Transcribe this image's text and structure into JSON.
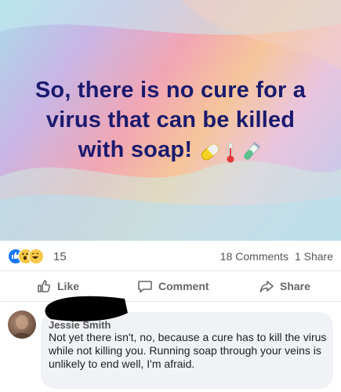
{
  "post": {
    "image_text_lines": [
      "So, there is no cure for a",
      "virus that can be killed",
      "with soap!"
    ],
    "emojis": [
      "pill-icon",
      "thermometer-icon",
      "test-tube-icon"
    ]
  },
  "stats": {
    "reaction_count": "15",
    "comments": "18 Comments",
    "shares": "1 Share",
    "reaction_icons": [
      "like-icon",
      "wow-icon",
      "haha-icon"
    ]
  },
  "actions": {
    "like": "Like",
    "comment": "Comment",
    "share": "Share"
  },
  "comment": {
    "author_visible": "Jessie Smith",
    "text": "Not yet there isn't, no, because a cure has to kill the virus while not killing you. Running soap through your veins is unlikely to end well, I'm afraid."
  },
  "colors": {
    "headline": "#1a1a6e",
    "like_blue": "#1877f2",
    "muted_text": "#65676b",
    "bubble": "#f0f2f5"
  }
}
